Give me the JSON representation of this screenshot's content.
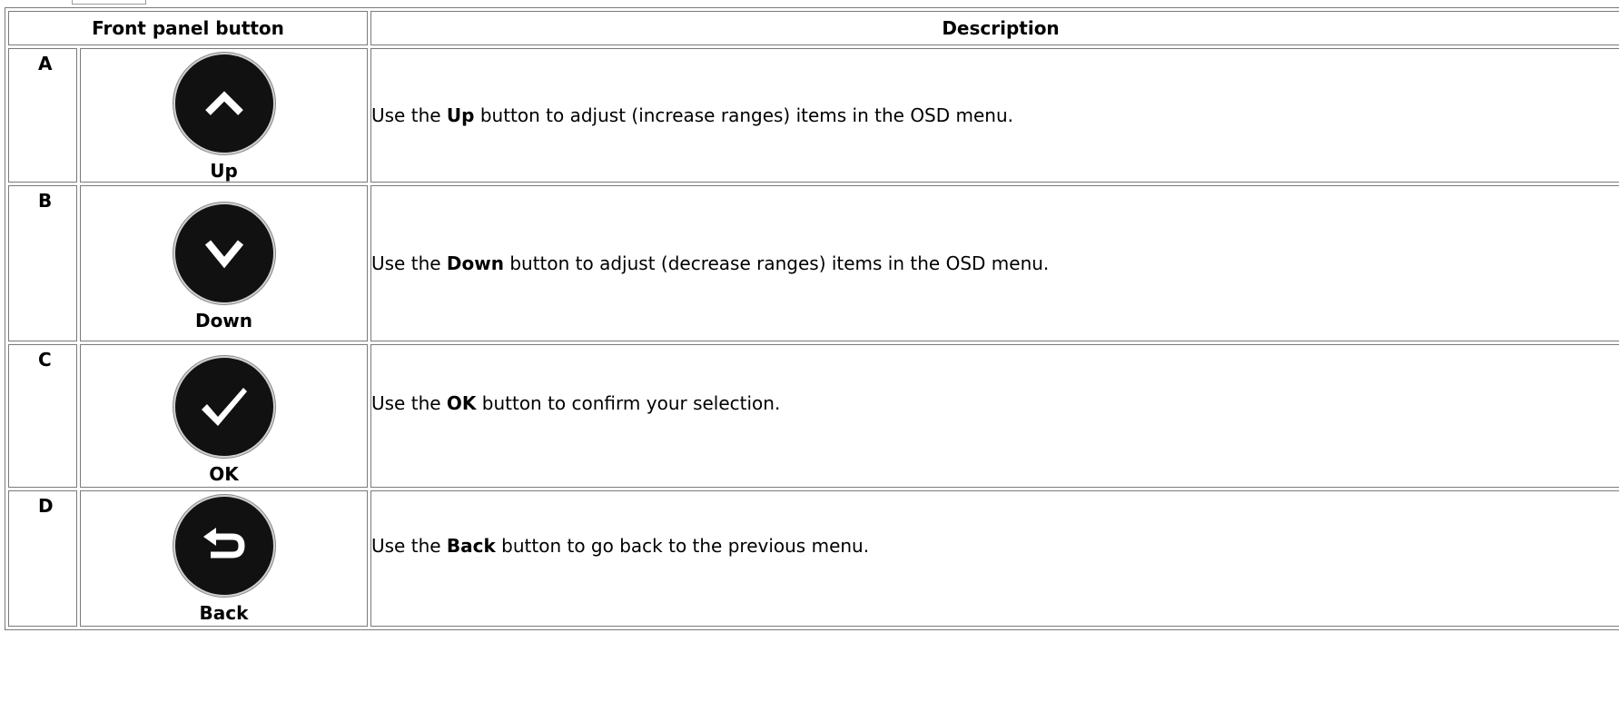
{
  "table": {
    "headers": {
      "front_panel": "Front panel button",
      "description": "Description"
    },
    "rows": [
      {
        "letter": "A",
        "icon": "chevron-up-icon",
        "label": "Up",
        "desc_before": "Use the ",
        "desc_bold": "Up",
        "desc_after": " button to adjust (increase ranges) items in the OSD menu."
      },
      {
        "letter": "B",
        "icon": "chevron-down-icon",
        "label": "Down",
        "desc_before": "Use the ",
        "desc_bold": "Down",
        "desc_after": " button to adjust (decrease ranges) items in the OSD menu."
      },
      {
        "letter": "C",
        "icon": "checkmark-icon",
        "label": "OK",
        "desc_before": "Use the ",
        "desc_bold": "OK",
        "desc_after": " button to confirm your selection."
      },
      {
        "letter": "D",
        "icon": "back-arrow-icon",
        "label": "Back",
        "desc_before": "Use the ",
        "desc_bold": "Back",
        "desc_after": " button to go back to the previous menu."
      }
    ]
  },
  "colors": {
    "button_fill": "#111111",
    "border": "#7a7a7a"
  }
}
